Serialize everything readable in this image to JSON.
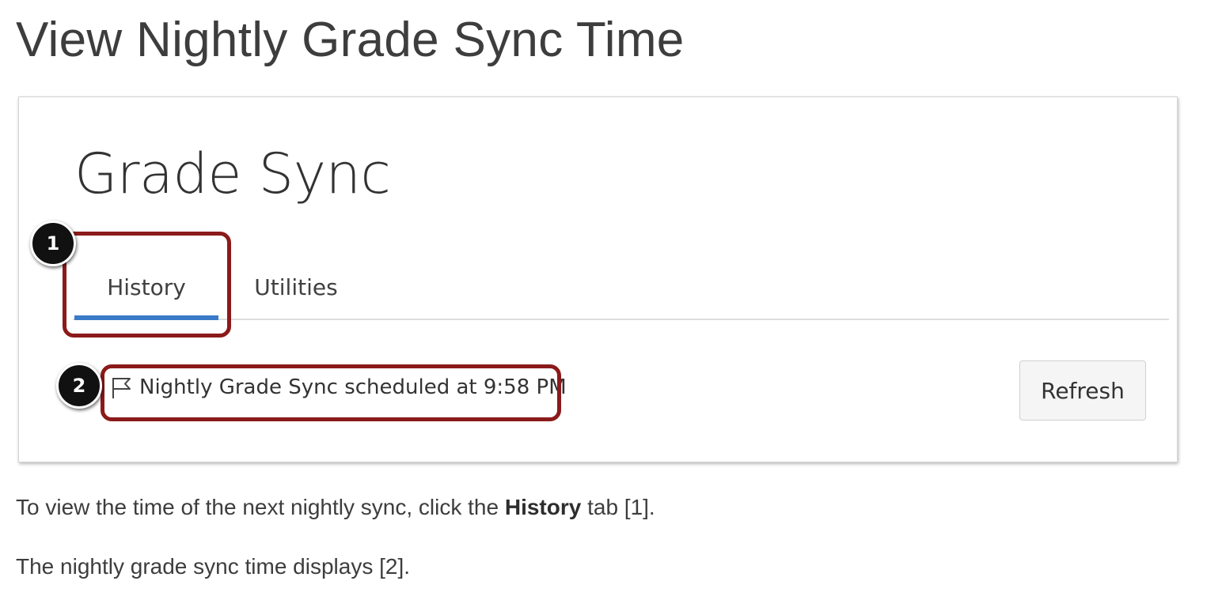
{
  "page": {
    "title": "View Nightly Grade Sync Time"
  },
  "app": {
    "heading": "Grade Sync",
    "tabs": [
      {
        "label": "History",
        "selected": true
      },
      {
        "label": "Utilities",
        "selected": false
      }
    ],
    "sync_status": {
      "icon": "flag-icon",
      "text": "Nightly Grade Sync scheduled at 9:58 PM"
    },
    "refresh_label": "Refresh",
    "accent_color": "#3a7bc8"
  },
  "callouts": [
    {
      "number": "1"
    },
    {
      "number": "2"
    }
  ],
  "callout_color": "#8b1a1a",
  "instructions": {
    "line1_before": "To view the time of the next nightly sync, click the ",
    "line1_bold": "History",
    "line1_after": " tab [1].",
    "line2": "The nightly grade sync time displays [2]."
  }
}
